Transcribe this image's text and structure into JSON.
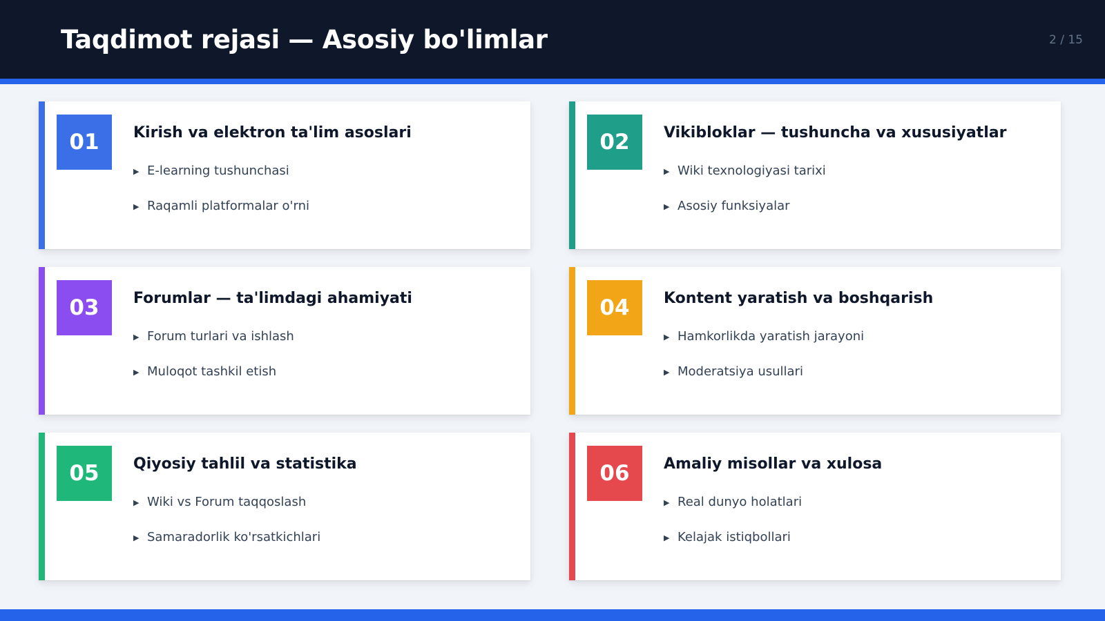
{
  "header": {
    "title": "Taqdimot rejasi — Asosiy bo'limlar",
    "page_indicator": "2 / 15"
  },
  "colors": {
    "header_bg": "#0f172a",
    "accent": "#2563eb"
  },
  "sections": [
    {
      "number": "01",
      "title": "Kirish va elektron ta'lim asoslari",
      "color": "#3b6fe8",
      "items": [
        "E-learning tushunchasi",
        "Raqamli platformalar o'rni"
      ]
    },
    {
      "number": "02",
      "title": "Vikibloklar — tushuncha va xususiyatlar",
      "color": "#1f9e8a",
      "items": [
        "Wiki texnologiyasi tarixi",
        "Asosiy funksiyalar"
      ]
    },
    {
      "number": "03",
      "title": "Forumlar — ta'limdagi ahamiyati",
      "color": "#8b4cf0",
      "items": [
        "Forum turlari va ishlash",
        "Muloqot tashkil etish"
      ]
    },
    {
      "number": "04",
      "title": "Kontent yaratish va boshqarish",
      "color": "#f2a516",
      "items": [
        "Hamkorlikda yaratish jarayoni",
        "Moderatsiya usullari"
      ]
    },
    {
      "number": "05",
      "title": "Qiyosiy tahlil va statistika",
      "color": "#20b87a",
      "items": [
        "Wiki vs Forum taqqoslash",
        "Samaradorlik ko'rsatkichlari"
      ]
    },
    {
      "number": "06",
      "title": "Amaliy misollar va xulosa",
      "color": "#e5484d",
      "items": [
        "Real dunyo holatlari",
        "Kelajak istiqbollari"
      ]
    }
  ]
}
